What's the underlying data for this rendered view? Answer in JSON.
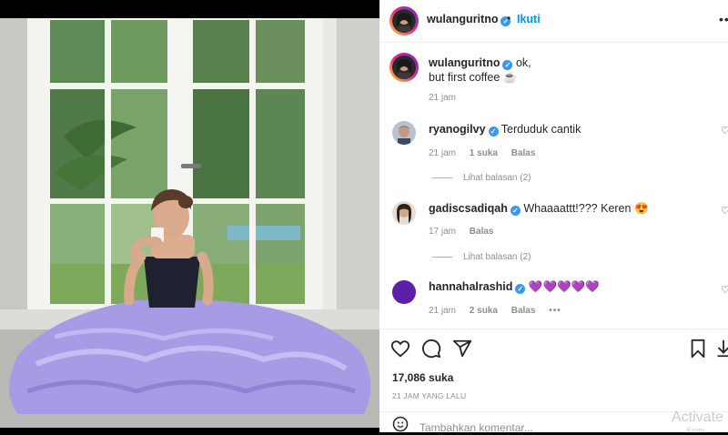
{
  "post": {
    "author": "wulanguritno",
    "follow_label": "Ikuti",
    "separator": "•",
    "more_label": "•••",
    "caption_line1": "ok,",
    "caption_line2": "but first coffee",
    "caption_emoji": "☕",
    "caption_time": "21 jam"
  },
  "comments": [
    {
      "user": "ryanogilvy",
      "text": "Terduduk cantik",
      "time": "21 jam",
      "likes": "1 suka",
      "reply": "Balas",
      "view_replies": "Lihat balasan (2)"
    },
    {
      "user": "gadiscsadiqah",
      "text": "Whaaaattt!??? Keren",
      "emoji": "😍",
      "time": "17 jam",
      "reply": "Balas",
      "view_replies": "Lihat balasan (2)"
    },
    {
      "user": "hannahalrashid",
      "text": "💜💜💜💜💜",
      "time": "21 jam",
      "likes": "2 suka",
      "reply": "Balas",
      "more": "•••"
    }
  ],
  "actions": {
    "like_icon": "heart-icon",
    "comment_icon": "comment-icon",
    "share_icon": "share-icon",
    "save_icon": "bookmark-icon",
    "likes_count": "17,086 suka",
    "posted_time": "21 JAM YANG LALU",
    "add_comment_placeholder": "Tambahkan komentar..."
  },
  "windows_watermark": {
    "line1": "Activate",
    "line2": "Kirim"
  },
  "colors": {
    "link_blue": "#0095f6",
    "verified_blue": "#3897f0",
    "dress_lavender": "#a89be6",
    "hannah_avatar": "#5b1fa8"
  }
}
